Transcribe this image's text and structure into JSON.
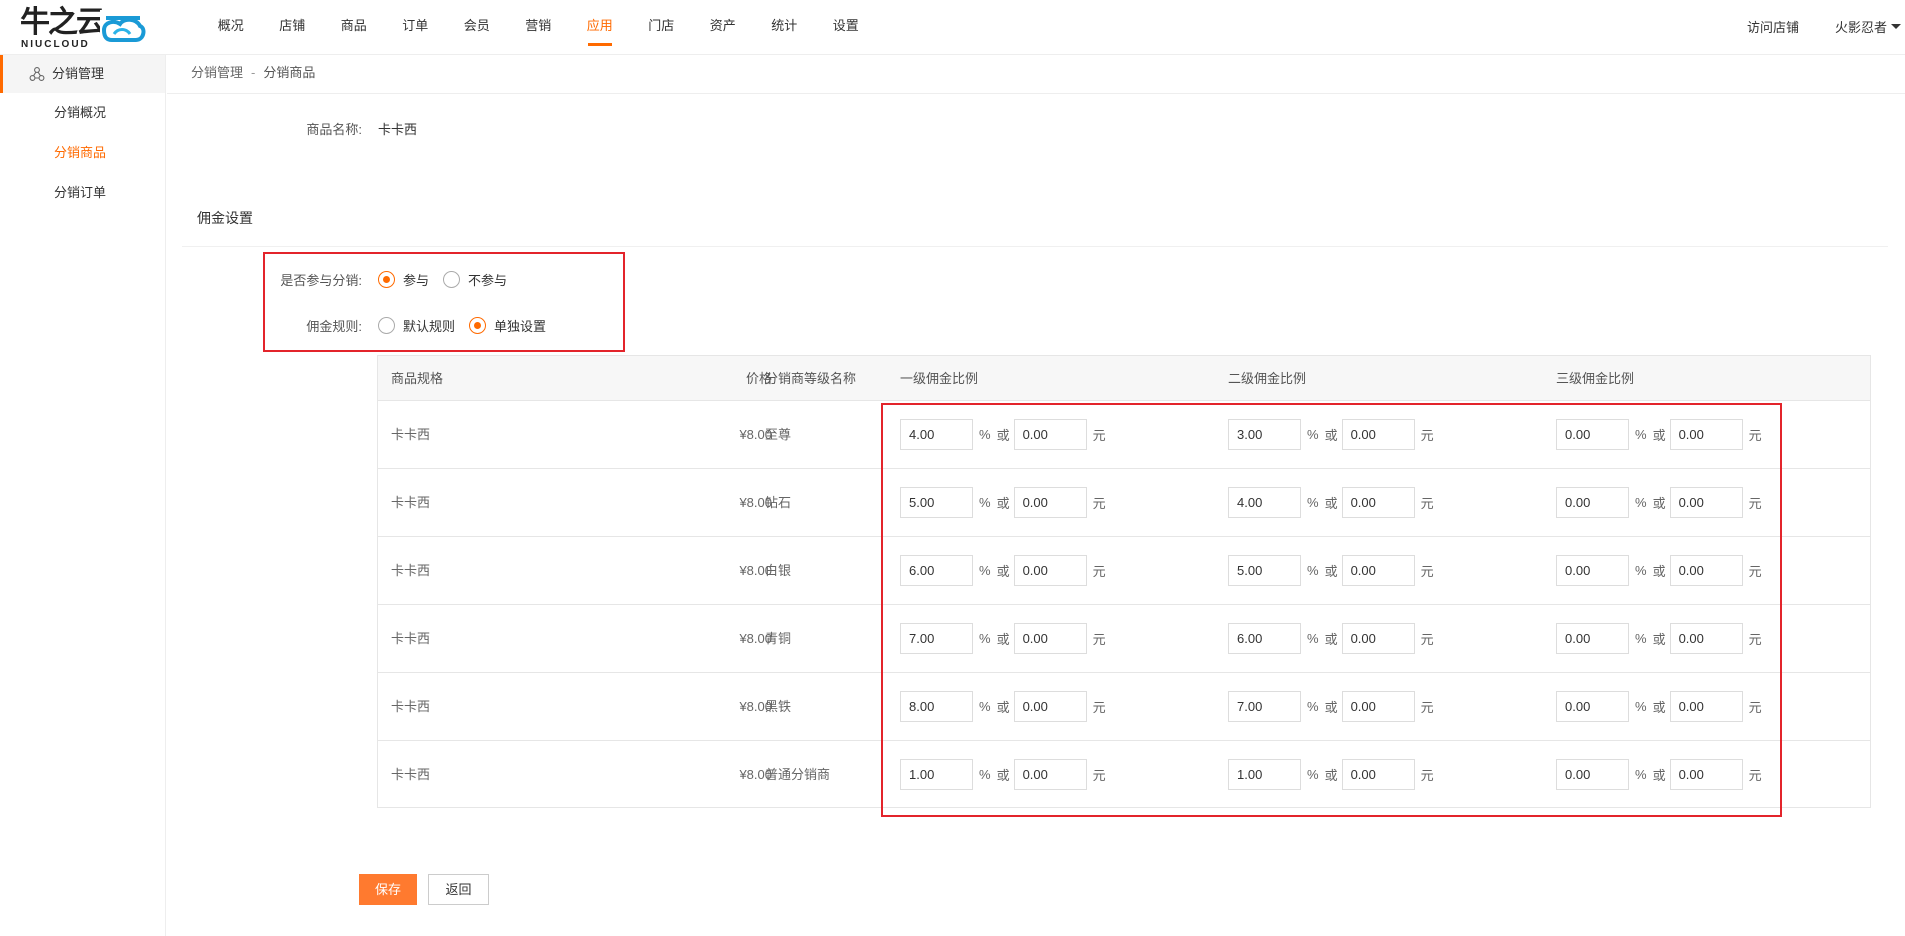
{
  "brand": {
    "logo_cn": "牛之云",
    "logo_en": "NIUCLOUD",
    "accent_color": "#ff6a00"
  },
  "nav": {
    "items": [
      {
        "label": "概况"
      },
      {
        "label": "店铺"
      },
      {
        "label": "商品"
      },
      {
        "label": "订单"
      },
      {
        "label": "会员"
      },
      {
        "label": "营销"
      },
      {
        "label": "应用",
        "active": true
      },
      {
        "label": "门店"
      },
      {
        "label": "资产"
      },
      {
        "label": "统计"
      },
      {
        "label": "设置"
      }
    ],
    "visit_store": "访问店铺",
    "user_name": "火影忍者"
  },
  "sidebar": {
    "group_label": "分销管理",
    "items": [
      {
        "label": "分销概况"
      },
      {
        "label": "分销商品",
        "active": true
      },
      {
        "label": "分销订单"
      }
    ]
  },
  "breadcrumb": {
    "parent": "分销管理",
    "separator": "-",
    "current": "分销商品"
  },
  "product": {
    "name_label": "商品名称:",
    "name_value": "卡卡西"
  },
  "commission": {
    "section_title": "佣金设置",
    "participate_label": "是否参与分销:",
    "participate_options": [
      "参与",
      "不参与"
    ],
    "participate_selected": "参与",
    "rule_label": "佣金规则:",
    "rule_options": [
      "默认规则",
      "单独设置"
    ],
    "rule_selected": "单独设置"
  },
  "table": {
    "headers": {
      "spec": "商品规格",
      "price": "价格",
      "level_name": "分销商等级名称",
      "level1": "一级佣金比例",
      "level2": "二级佣金比例",
      "level3": "三级佣金比例"
    },
    "percent_unit": "%",
    "or_text": "或",
    "yuan_unit": "元",
    "rows": [
      {
        "spec": "卡卡西",
        "price": "¥8.00",
        "level": "至尊",
        "l1_pct": "4.00",
        "l1_amt": "0.00",
        "l2_pct": "3.00",
        "l2_amt": "0.00",
        "l3_pct": "0.00",
        "l3_amt": "0.00"
      },
      {
        "spec": "卡卡西",
        "price": "¥8.00",
        "level": "钻石",
        "l1_pct": "5.00",
        "l1_amt": "0.00",
        "l2_pct": "4.00",
        "l2_amt": "0.00",
        "l3_pct": "0.00",
        "l3_amt": "0.00"
      },
      {
        "spec": "卡卡西",
        "price": "¥8.00",
        "level": "白银",
        "l1_pct": "6.00",
        "l1_amt": "0.00",
        "l2_pct": "5.00",
        "l2_amt": "0.00",
        "l3_pct": "0.00",
        "l3_amt": "0.00"
      },
      {
        "spec": "卡卡西",
        "price": "¥8.00",
        "level": "青铜",
        "l1_pct": "7.00",
        "l1_amt": "0.00",
        "l2_pct": "6.00",
        "l2_amt": "0.00",
        "l3_pct": "0.00",
        "l3_amt": "0.00"
      },
      {
        "spec": "卡卡西",
        "price": "¥8.00",
        "level": "黑铁",
        "l1_pct": "8.00",
        "l1_amt": "0.00",
        "l2_pct": "7.00",
        "l2_amt": "0.00",
        "l3_pct": "0.00",
        "l3_amt": "0.00"
      },
      {
        "spec": "卡卡西",
        "price": "¥8.00",
        "level": "普通分销商",
        "l1_pct": "1.00",
        "l1_amt": "0.00",
        "l2_pct": "1.00",
        "l2_amt": "0.00",
        "l3_pct": "0.00",
        "l3_amt": "0.00"
      }
    ]
  },
  "actions": {
    "save": "保存",
    "back": "返回"
  }
}
